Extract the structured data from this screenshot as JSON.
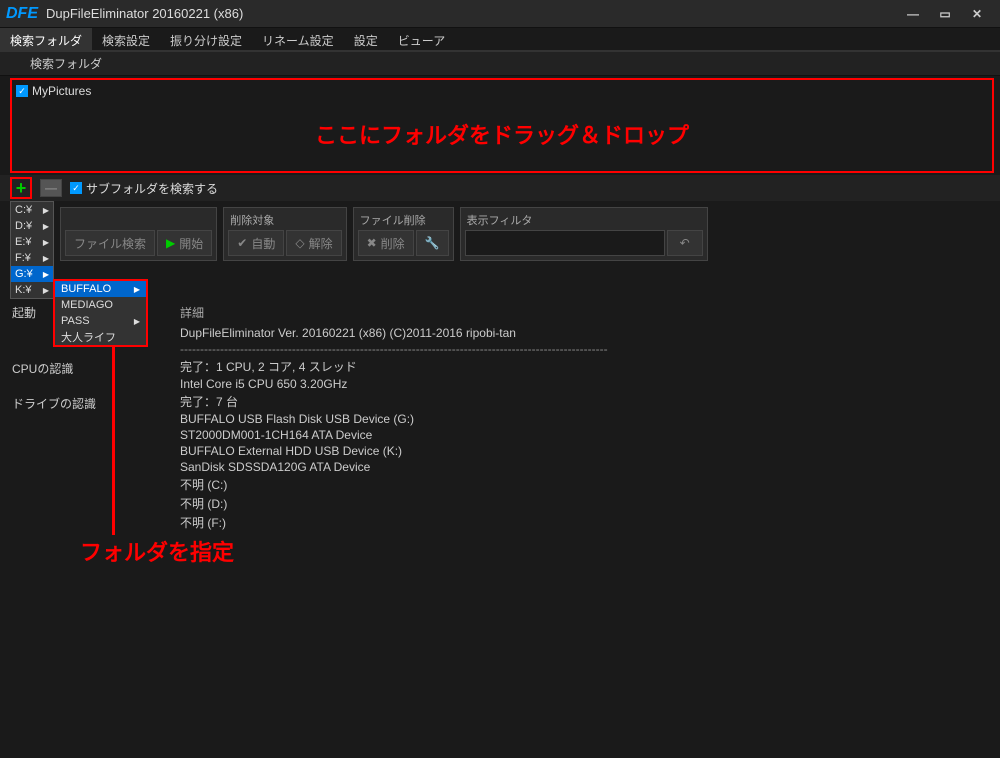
{
  "window": {
    "logo": "DFE",
    "title": "DupFileEliminator 20160221 (x86)"
  },
  "tabs": [
    "検索フォルダ",
    "検索設定",
    "振り分け設定",
    "リネーム設定",
    "設定",
    "ビューア"
  ],
  "subhead": "検索フォルダ",
  "dropzone": {
    "item": "MyPictures",
    "overlay": "ここにフォルダをドラッグ＆ドロップ"
  },
  "toolbar1": {
    "subfolder_label": "サブフォルダを検索する"
  },
  "drives": [
    "C:¥",
    "D:¥",
    "E:¥",
    "F:¥",
    "G:¥",
    "K:¥"
  ],
  "submenu": [
    "BUFFALO",
    "MEDIAGO",
    "PASS",
    "大人ライフ"
  ],
  "groups": {
    "search_hdr": "",
    "search_btn1": "ファイル検索",
    "search_btn2": "開始",
    "del_target_hdr": "削除対象",
    "del_target_auto": "自動",
    "del_target_clear": "解除",
    "file_del_hdr": "ファイル削除",
    "file_del_btn": "削除",
    "filter_hdr": "表示フィルタ"
  },
  "annotation": "フォルダを指定",
  "side": {
    "boot": "起動",
    "cpu": "CPUの認識",
    "drive": "ドライブの認識"
  },
  "details": {
    "head": "詳細",
    "version": "DupFileEliminator Ver. 20160221 (x86) (C)2011-2016 ripobi-tan",
    "sep": "-----------------------------------------------------------------------------------------------------------",
    "cpu_done": "完了：1 CPU, 2 コア, 4 スレッド",
    "cpu_model": "Intel Core i5 CPU 650 3.20GHz",
    "drive_done": "完了：7 台",
    "d1": "BUFFALO USB Flash Disk USB Device (G:)",
    "d2": "ST2000DM001-1CH164 ATA Device",
    "d3": "BUFFALO External HDD USB Device (K:)",
    "d4": "SanDisk SDSSDA120G ATA Device",
    "d5": "不明 (C:)",
    "d6": "不明 (D:)",
    "d7": "不明 (F:)"
  }
}
